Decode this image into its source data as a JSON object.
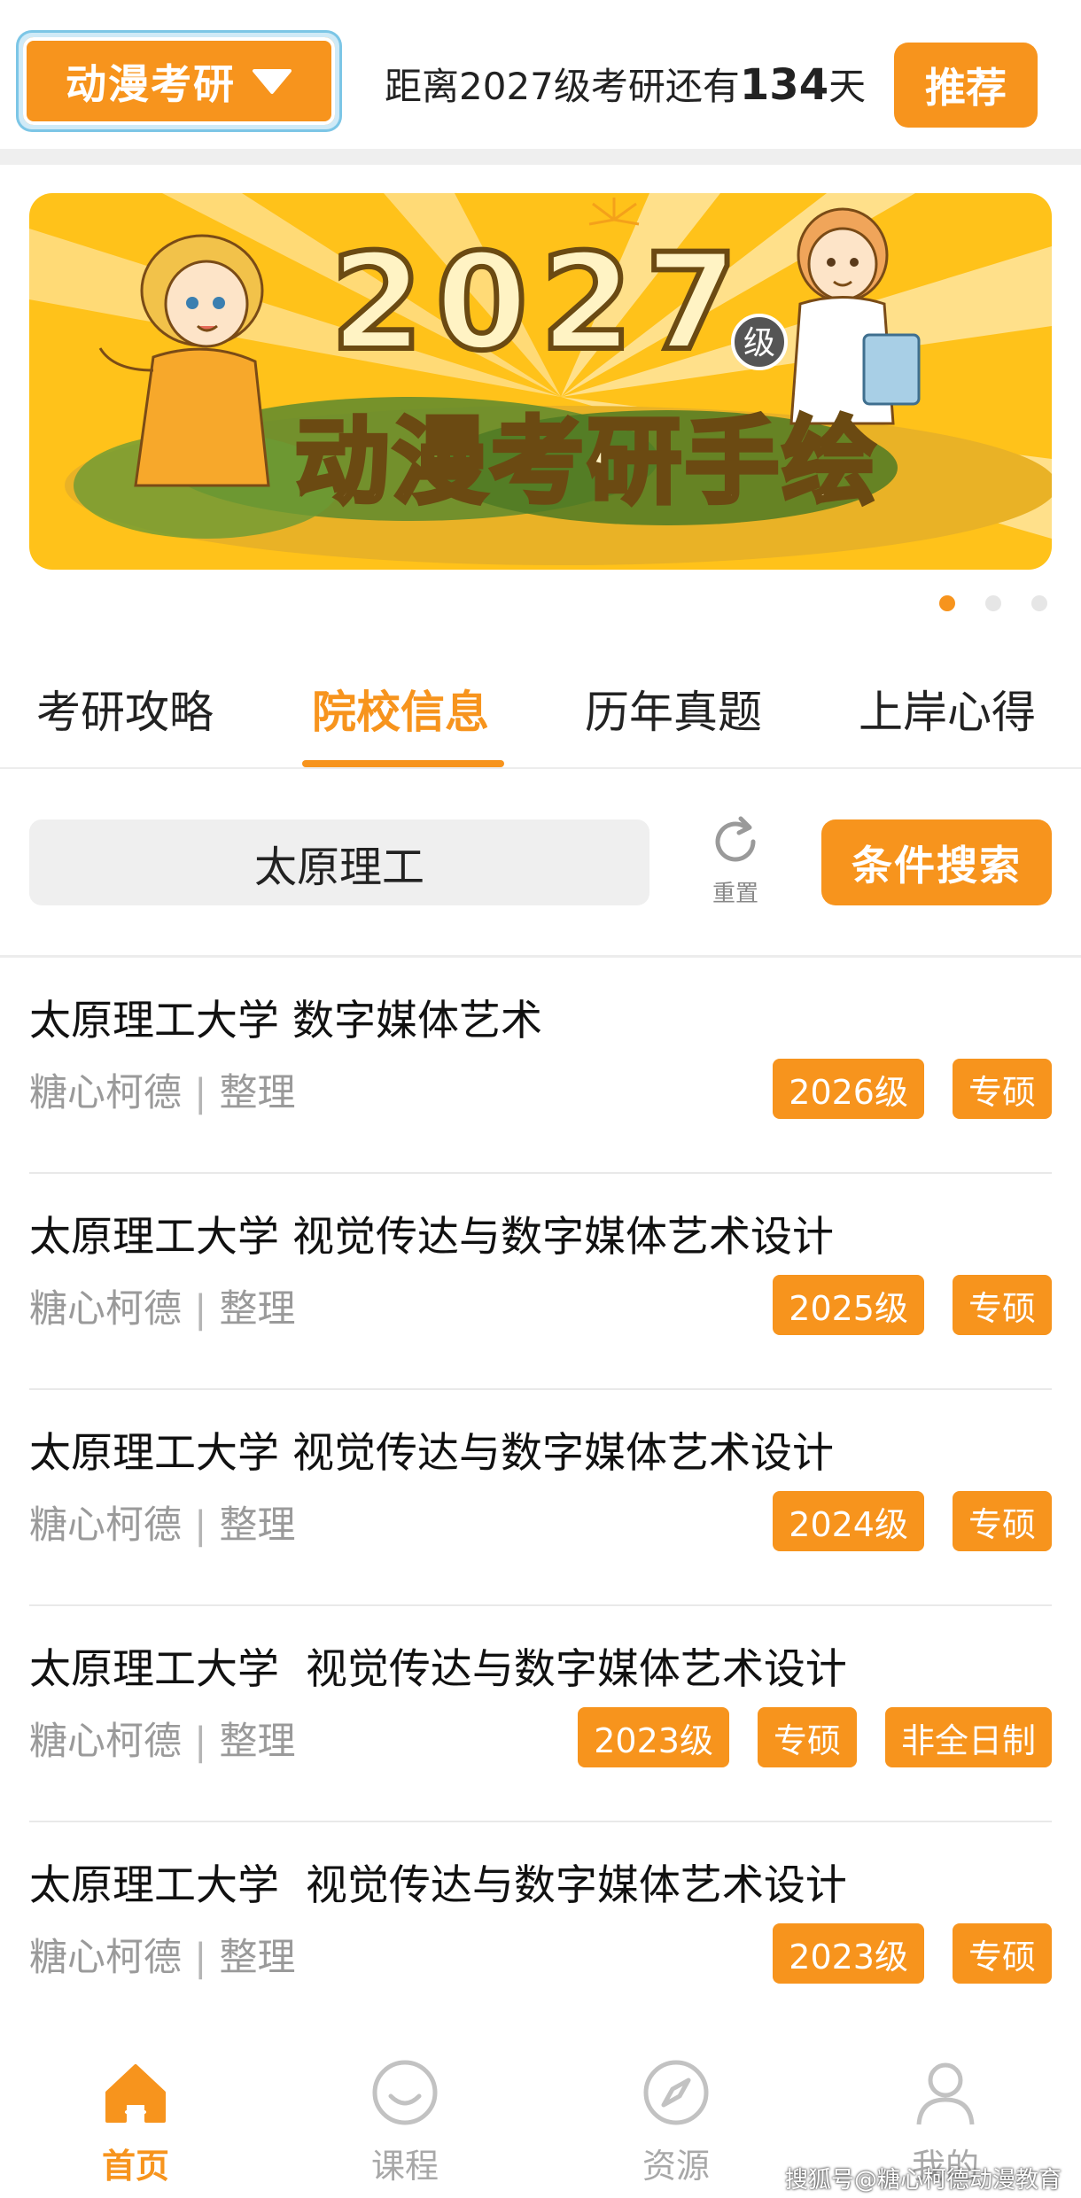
{
  "header": {
    "category": "动漫考研",
    "countdown_prefix": "距离2027级考研还有",
    "countdown_days": "134",
    "countdown_suffix": "天",
    "recommend_label": "推荐"
  },
  "banner": {
    "big_year": "2027",
    "grade_badge": "级",
    "title": "动漫考研手绘"
  },
  "carousel": {
    "count": 3,
    "active_index": 0
  },
  "tabs": [
    {
      "label": "考研攻略",
      "active": false
    },
    {
      "label": "院校信息",
      "active": true
    },
    {
      "label": "历年真题",
      "active": false
    },
    {
      "label": "上岸心得",
      "active": false
    }
  ],
  "search": {
    "value": "太原理工",
    "reset_label": "重置",
    "search_button_label": "条件搜索"
  },
  "list": [
    {
      "title": "太原理工大学 数字媒体艺术",
      "author": "糖心柯德",
      "separator": "|",
      "action": "整理",
      "tags": [
        "2026级",
        "专硕"
      ]
    },
    {
      "title": "太原理工大学 视觉传达与数字媒体艺术设计",
      "author": "糖心柯德",
      "separator": "|",
      "action": "整理",
      "tags": [
        "2025级",
        "专硕"
      ]
    },
    {
      "title": "太原理工大学 视觉传达与数字媒体艺术设计",
      "author": "糖心柯德",
      "separator": "|",
      "action": "整理",
      "tags": [
        "2024级",
        "专硕"
      ]
    },
    {
      "title": "太原理工大学  视觉传达与数字媒体艺术设计",
      "author": "糖心柯德",
      "separator": "|",
      "action": "整理",
      "tags": [
        "2023级",
        "专硕",
        "非全日制"
      ]
    },
    {
      "title": "太原理工大学  视觉传达与数字媒体艺术设计",
      "author": "糖心柯德",
      "separator": "|",
      "action": "整理",
      "tags": [
        "2023级",
        "专硕"
      ]
    }
  ],
  "bottom_nav": [
    {
      "label": "首页",
      "icon": "home-icon",
      "active": true
    },
    {
      "label": "课程",
      "icon": "smile-icon",
      "active": false
    },
    {
      "label": "资源",
      "icon": "compass-icon",
      "active": false
    },
    {
      "label": "我的",
      "icon": "user-icon",
      "active": false
    }
  ],
  "watermark": "搜狐号@糖心柯德动漫教育",
  "colors": {
    "accent": "#f7941d",
    "banner_bg": "#ffc21a",
    "muted_text": "#9a9a9a"
  }
}
